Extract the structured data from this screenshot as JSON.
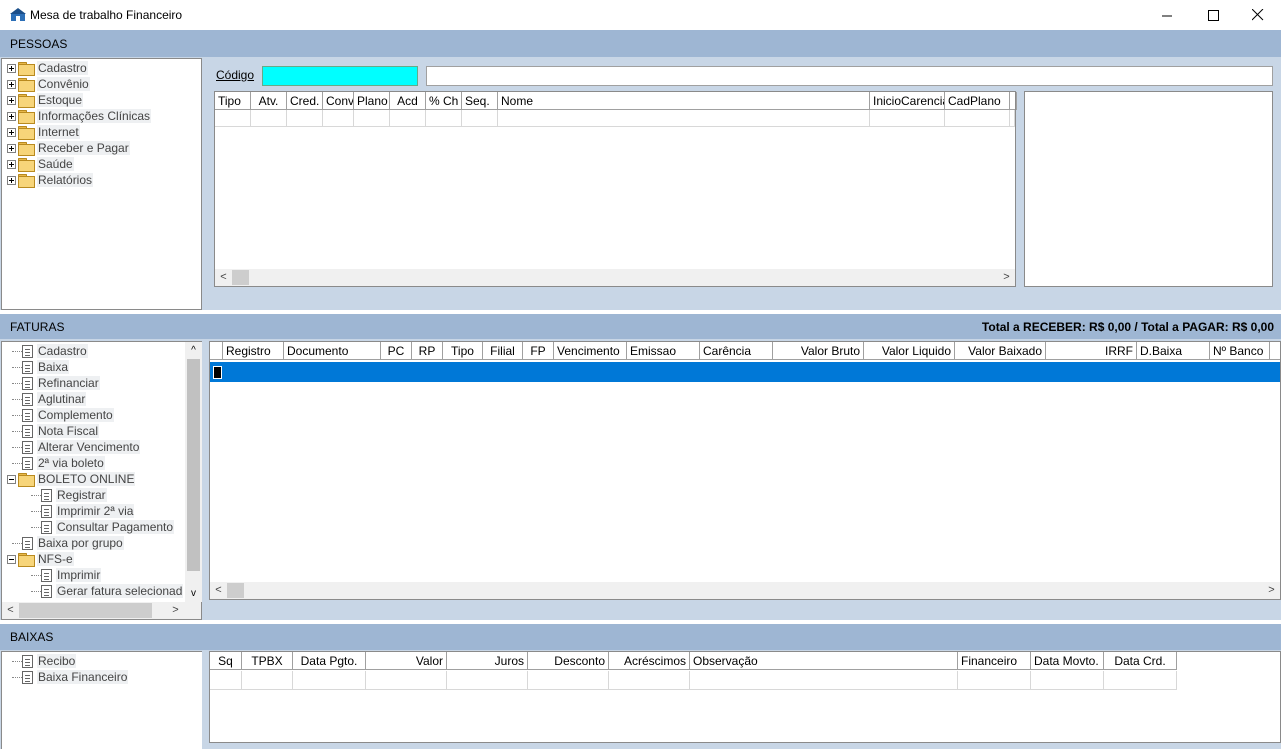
{
  "window": {
    "title": "Mesa de trabalho Financeiro",
    "minimize": "—",
    "maximize": "☐",
    "close": "✕"
  },
  "pessoas": {
    "title": "PESSOAS",
    "tree": [
      "Cadastro",
      "Convênio",
      "Estoque",
      "Informações Clínicas",
      "Internet",
      "Receber e Pagar",
      "Saúde",
      "Relatórios"
    ],
    "codigo_label": "Código",
    "codigo_value": "",
    "description_value": "",
    "columns": [
      "Tipo",
      "Atv.",
      "Cred.",
      "Conv.",
      "Plano",
      "Acd",
      "% Ch",
      "Seq.",
      "Nome",
      "InicioCarencia",
      "CadPlano",
      ""
    ]
  },
  "faturas": {
    "title": "FATURAS",
    "totals": "Total a RECEBER: R$ 0,00 / Total a PAGAR: R$ 0,00",
    "tree": [
      {
        "label": "Cadastro",
        "type": "doc",
        "level": 1
      },
      {
        "label": "Baixa",
        "type": "doc",
        "level": 1
      },
      {
        "label": "Refinanciar",
        "type": "doc",
        "level": 1
      },
      {
        "label": "Aglutinar",
        "type": "doc",
        "level": 1
      },
      {
        "label": "Complemento",
        "type": "doc",
        "level": 1
      },
      {
        "label": "Nota Fiscal",
        "type": "doc",
        "level": 1
      },
      {
        "label": "Alterar Vencimento",
        "type": "doc",
        "level": 1
      },
      {
        "label": "2ª via boleto",
        "type": "doc",
        "level": 1
      },
      {
        "label": "BOLETO ONLINE",
        "type": "folder",
        "level": 0
      },
      {
        "label": "Registrar",
        "type": "doc",
        "level": 2
      },
      {
        "label": "Imprimir 2ª via",
        "type": "doc",
        "level": 2
      },
      {
        "label": "Consultar Pagamento",
        "type": "doc",
        "level": 2
      },
      {
        "label": "Baixa por grupo",
        "type": "doc",
        "level": 1
      },
      {
        "label": "NFS-e",
        "type": "folder",
        "level": 0
      },
      {
        "label": "Imprimir",
        "type": "doc",
        "level": 2
      },
      {
        "label": "Gerar fatura selecionad",
        "type": "doc",
        "level": 2
      }
    ],
    "columns": [
      "Registro",
      "Documento",
      "PC",
      "RP",
      "Tipo",
      "Filial",
      "FP",
      "Vencimento",
      "Emissao",
      "Carência",
      "Valor Bruto",
      "Valor Liquido",
      "Valor Baixado",
      "IRRF",
      "D.Baixa",
      "Nº Banco"
    ]
  },
  "baixas": {
    "title": "BAIXAS",
    "tree": [
      "Recibo",
      "Baixa Financeiro"
    ],
    "columns": [
      "Sq",
      "TPBX",
      "Data Pgto.",
      "Valor",
      "Juros",
      "Desconto",
      "Acréscimos",
      "Observação",
      "Financeiro",
      "Data Movto.",
      "Data Crd."
    ]
  },
  "colors": {
    "section_bar": "#9eb6d3",
    "background": "#c8d6e6",
    "selection": "#0078d7",
    "codigo_field": "#00ffff"
  }
}
